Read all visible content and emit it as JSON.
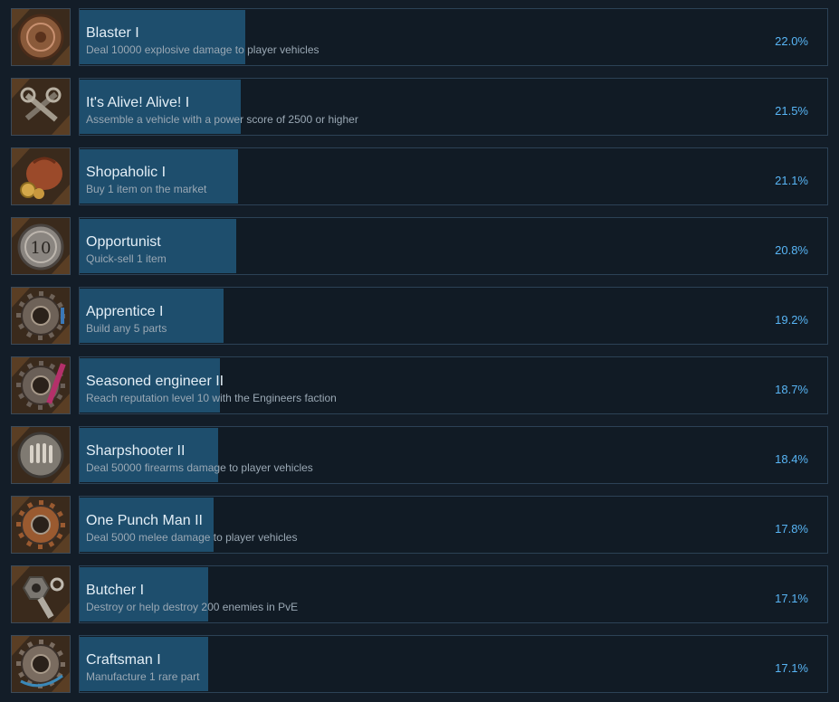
{
  "colors": {
    "background": "#131d28",
    "panel": "#111b25",
    "panel_border": "#2c4256",
    "bar_fill": "#1e4e6d",
    "percent_text": "#58b5f5",
    "title_text": "#e3eef6",
    "desc_text": "#9aa8b4"
  },
  "achievements": [
    {
      "title": "Blaster I",
      "description": "Deal 10000 explosive damage to player vehicles",
      "percent": "22.0%",
      "value": 22.0,
      "icon": "explosive-medal-icon",
      "icon_color": "#8a5a3a"
    },
    {
      "title": "It's Alive! Alive! I",
      "description": "Assemble a vehicle with a power score of 2500 or higher",
      "percent": "21.5%",
      "value": 21.5,
      "icon": "wrenches-icon",
      "icon_color": "#7d7468"
    },
    {
      "title": "Shopaholic I",
      "description": "Buy 1 item on the market",
      "percent": "21.1%",
      "value": 21.1,
      "icon": "coin-pouch-icon",
      "icon_color": "#9b4a2a"
    },
    {
      "title": "Opportunist",
      "description": "Quick-sell 1 item",
      "percent": "20.8%",
      "value": 20.8,
      "icon": "ten-coin-icon",
      "icon_color": "#8a8580"
    },
    {
      "title": "Apprentice I",
      "description": "Build any 5 parts",
      "percent": "19.2%",
      "value": 19.2,
      "icon": "gear-icon",
      "icon_color": "#6e6258"
    },
    {
      "title": "Seasoned engineer II",
      "description": "Reach reputation level 10 with the Engineers faction",
      "percent": "18.7%",
      "value": 18.7,
      "icon": "engineer-gear-icon",
      "icon_color": "#6a5f57"
    },
    {
      "title": "Sharpshooter II",
      "description": "Deal 50000 firearms damage to player vehicles",
      "percent": "18.4%",
      "value": 18.4,
      "icon": "bullets-medal-icon",
      "icon_color": "#7f7a72"
    },
    {
      "title": "One Punch Man II",
      "description": "Deal 5000 melee damage to player vehicles",
      "percent": "17.8%",
      "value": 17.8,
      "icon": "saw-blade-icon",
      "icon_color": "#9a5a30"
    },
    {
      "title": "Butcher I",
      "description": "Destroy or help destroy 200 enemies in PvE",
      "percent": "17.1%",
      "value": 17.1,
      "icon": "nuts-bolts-icon",
      "icon_color": "#7a7670"
    },
    {
      "title": "Craftsman I",
      "description": "Manufacture 1 rare part",
      "percent": "17.1%",
      "value": 17.1,
      "icon": "spool-icon",
      "icon_color": "#7a6c60"
    }
  ]
}
